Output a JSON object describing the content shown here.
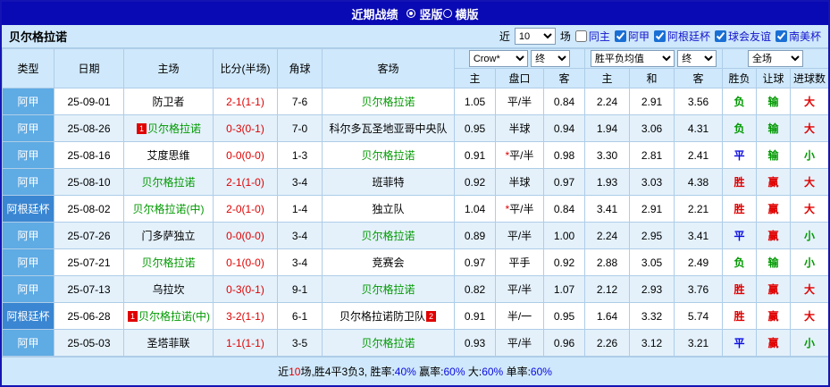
{
  "titlebar": {
    "title": "近期战绩",
    "radios": [
      {
        "label": "竖版",
        "selected": true
      },
      {
        "label": "横版",
        "selected": false
      }
    ]
  },
  "filterbar": {
    "team": "贝尔格拉诺",
    "near_label": "近",
    "count_value": "10",
    "games_label": "场",
    "checkboxes": [
      {
        "label": "同主",
        "checked": false
      },
      {
        "label": "阿甲",
        "checked": true
      },
      {
        "label": "阿根廷杯",
        "checked": true
      },
      {
        "label": "球会友谊",
        "checked": true
      },
      {
        "label": "南美杯",
        "checked": true
      }
    ]
  },
  "table": {
    "headers": {
      "type": "类型",
      "date": "日期",
      "home": "主场",
      "score": "比分(半场)",
      "corner": "角球",
      "away": "客场",
      "sub": [
        "主",
        "盘口",
        "客",
        "主",
        "和",
        "客",
        "胜负",
        "让球",
        "进球数"
      ]
    },
    "controls": {
      "odds_company": "Crow*",
      "odds_stage": "终",
      "europe_average": "胜平负均值",
      "europe_stage": "终",
      "fulltime_scope": "全场"
    },
    "rows": [
      {
        "league": "阿甲",
        "cup": false,
        "date": "25-09-01",
        "home": {
          "name": "防卫者",
          "subject": false
        },
        "score": "2-1(1-1)",
        "corner": "7-6",
        "away": {
          "name": "贝尔格拉诺",
          "subject": true
        },
        "asia": [
          "1.05",
          "平/半",
          "0.84"
        ],
        "asia_star": false,
        "europe": [
          "2.24",
          "2.91",
          "3.56"
        ],
        "result": {
          "text": "负",
          "tone": "green"
        },
        "handicap_result": {
          "text": "输",
          "tone": "green"
        },
        "goals": {
          "text": "大",
          "tone": "red"
        }
      },
      {
        "league": "阿甲",
        "cup": false,
        "date": "25-08-26",
        "home": {
          "name": "贝尔格拉诺",
          "subject": true,
          "badge_before": "1"
        },
        "score": "0-3(0-1)",
        "corner": "7-0",
        "away": {
          "name": "科尔多瓦圣地亚哥中央队",
          "subject": false
        },
        "asia": [
          "0.95",
          "半球",
          "0.94"
        ],
        "asia_star": false,
        "europe": [
          "1.94",
          "3.06",
          "4.31"
        ],
        "result": {
          "text": "负",
          "tone": "green"
        },
        "handicap_result": {
          "text": "输",
          "tone": "green"
        },
        "goals": {
          "text": "大",
          "tone": "red"
        }
      },
      {
        "league": "阿甲",
        "cup": false,
        "date": "25-08-16",
        "home": {
          "name": "艾度思维",
          "subject": false
        },
        "score": "0-0(0-0)",
        "corner": "1-3",
        "away": {
          "name": "贝尔格拉诺",
          "subject": true
        },
        "asia": [
          "0.91",
          "平/半",
          "0.98"
        ],
        "asia_star": true,
        "europe": [
          "3.30",
          "2.81",
          "2.41"
        ],
        "result": {
          "text": "平",
          "tone": "blue"
        },
        "handicap_result": {
          "text": "输",
          "tone": "green"
        },
        "goals": {
          "text": "小",
          "tone": "green"
        }
      },
      {
        "league": "阿甲",
        "cup": false,
        "date": "25-08-10",
        "home": {
          "name": "贝尔格拉诺",
          "subject": true
        },
        "score": "2-1(1-0)",
        "corner": "3-4",
        "away": {
          "name": "班菲特",
          "subject": false
        },
        "asia": [
          "0.92",
          "半球",
          "0.97"
        ],
        "asia_star": false,
        "europe": [
          "1.93",
          "3.03",
          "4.38"
        ],
        "result": {
          "text": "胜",
          "tone": "red"
        },
        "handicap_result": {
          "text": "赢",
          "tone": "red"
        },
        "goals": {
          "text": "大",
          "tone": "red"
        }
      },
      {
        "league": "阿根廷杯",
        "cup": true,
        "date": "25-08-02",
        "home": {
          "name": "贝尔格拉诺(中)",
          "subject": true
        },
        "score": "2-0(1-0)",
        "corner": "1-4",
        "away": {
          "name": "独立队",
          "subject": false
        },
        "asia": [
          "1.04",
          "平/半",
          "0.84"
        ],
        "asia_star": true,
        "europe": [
          "3.41",
          "2.91",
          "2.21"
        ],
        "result": {
          "text": "胜",
          "tone": "red"
        },
        "handicap_result": {
          "text": "赢",
          "tone": "red"
        },
        "goals": {
          "text": "大",
          "tone": "red"
        }
      },
      {
        "league": "阿甲",
        "cup": false,
        "date": "25-07-26",
        "home": {
          "name": "门多萨独立",
          "subject": false
        },
        "score": "0-0(0-0)",
        "corner": "3-4",
        "away": {
          "name": "贝尔格拉诺",
          "subject": true
        },
        "asia": [
          "0.89",
          "平/半",
          "1.00"
        ],
        "asia_star": false,
        "europe": [
          "2.24",
          "2.95",
          "3.41"
        ],
        "result": {
          "text": "平",
          "tone": "blue"
        },
        "handicap_result": {
          "text": "赢",
          "tone": "red"
        },
        "goals": {
          "text": "小",
          "tone": "green"
        }
      },
      {
        "league": "阿甲",
        "cup": false,
        "date": "25-07-21",
        "home": {
          "name": "贝尔格拉诺",
          "subject": true
        },
        "score": "0-1(0-0)",
        "corner": "3-4",
        "away": {
          "name": "竞赛会",
          "subject": false
        },
        "asia": [
          "0.97",
          "平手",
          "0.92"
        ],
        "asia_star": false,
        "europe": [
          "2.88",
          "3.05",
          "2.49"
        ],
        "result": {
          "text": "负",
          "tone": "green"
        },
        "handicap_result": {
          "text": "输",
          "tone": "green"
        },
        "goals": {
          "text": "小",
          "tone": "green"
        }
      },
      {
        "league": "阿甲",
        "cup": false,
        "date": "25-07-13",
        "home": {
          "name": "乌拉坎",
          "subject": false
        },
        "score": "0-3(0-1)",
        "corner": "9-1",
        "away": {
          "name": "贝尔格拉诺",
          "subject": true
        },
        "asia": [
          "0.82",
          "平/半",
          "1.07"
        ],
        "asia_star": false,
        "europe": [
          "2.12",
          "2.93",
          "3.76"
        ],
        "result": {
          "text": "胜",
          "tone": "red"
        },
        "handicap_result": {
          "text": "赢",
          "tone": "red"
        },
        "goals": {
          "text": "大",
          "tone": "red"
        }
      },
      {
        "league": "阿根廷杯",
        "cup": true,
        "date": "25-06-28",
        "home": {
          "name": "贝尔格拉诺(中)",
          "subject": true,
          "badge_before": "1"
        },
        "score": "3-2(1-1)",
        "corner": "6-1",
        "away": {
          "name": "贝尔格拉诺防卫队",
          "subject": false,
          "badge_after": "2"
        },
        "asia": [
          "0.91",
          "半/一",
          "0.95"
        ],
        "asia_star": false,
        "europe": [
          "1.64",
          "3.32",
          "5.74"
        ],
        "result": {
          "text": "胜",
          "tone": "red"
        },
        "handicap_result": {
          "text": "赢",
          "tone": "red"
        },
        "goals": {
          "text": "大",
          "tone": "red"
        }
      },
      {
        "league": "阿甲",
        "cup": false,
        "date": "25-05-03",
        "home": {
          "name": "圣塔菲联",
          "subject": false
        },
        "score": "1-1(1-1)",
        "corner": "3-5",
        "away": {
          "name": "贝尔格拉诺",
          "subject": true
        },
        "asia": [
          "0.93",
          "平/半",
          "0.96"
        ],
        "asia_star": false,
        "europe": [
          "2.26",
          "3.12",
          "3.21"
        ],
        "result": {
          "text": "平",
          "tone": "blue"
        },
        "handicap_result": {
          "text": "赢",
          "tone": "red"
        },
        "goals": {
          "text": "小",
          "tone": "green"
        }
      }
    ]
  },
  "footer": {
    "segments": [
      {
        "text": "近"
      },
      {
        "text": "10",
        "tone": "red"
      },
      {
        "text": "场,胜4平3负3, 胜率:"
      },
      {
        "text": "40%",
        "tone": "blue"
      },
      {
        "text": " 赢率:"
      },
      {
        "text": "60%",
        "tone": "blue"
      },
      {
        "text": " 大:"
      },
      {
        "text": "60%",
        "tone": "blue"
      },
      {
        "text": " 单率:"
      },
      {
        "text": "60%",
        "tone": "blue"
      }
    ]
  },
  "colors": {
    "accent_blue": "#0a0ab4",
    "panel_blue": "#cfe8fb",
    "league_primary": "#5fabe4",
    "league_cup": "#3a86d2",
    "subject_green": "#009900",
    "score_red": "#e00000"
  }
}
